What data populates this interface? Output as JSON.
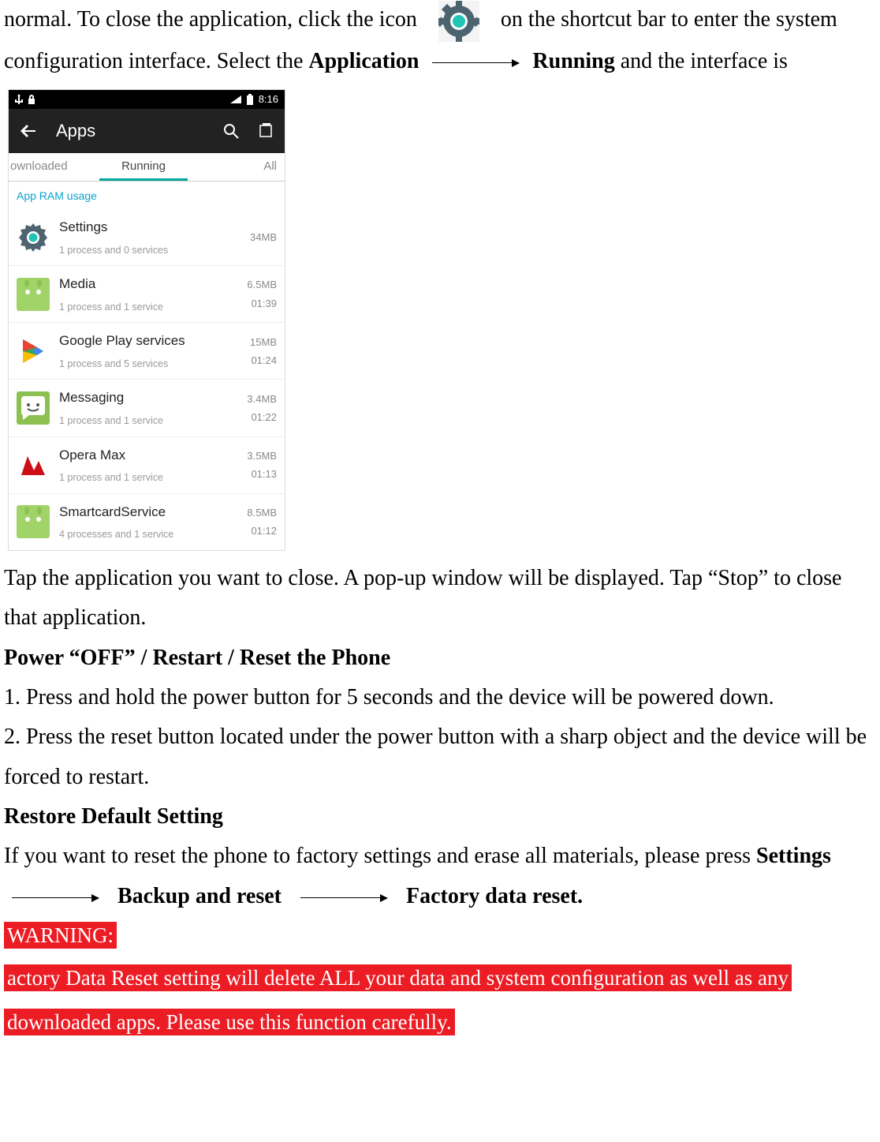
{
  "doc": {
    "p1_a": "normal. To close the application, click the icon",
    "p1_b": "on the shortcut bar to enter the system configuration interface. Select the ",
    "application_bold": "Application",
    "running_bold": "Running",
    "p1_c": " and the interface is",
    "p2": "Tap the application you want to close. A pop-up window will be displayed. Tap “Stop” to close that application.",
    "h1": "Power “OFF” / Restart / Reset the Phone",
    "li1": "1.    Press and hold the power button for 5 seconds and the device will be powered down.",
    "li2": "2. Press the reset button located under the power button with a sharp object and the device will be forced to restart.",
    "h2": "Restore Default Setting",
    "p3_a": "If you want to reset the phone to factory settings and erase all materials, please press ",
    "settings_bold": "Settings",
    "backup_bold": "Backup and reset",
    "factory_bold": "Factory data reset.",
    "warn_label": "WARNING:",
    "warn_text_a": "actory Data Reset setting will delete ALL your data and system conﬁguration as well as any",
    "warn_text_b": "downloaded apps. Please use this function carefully."
  },
  "phone": {
    "time": "8:16",
    "title": "Apps",
    "tabs": {
      "downloaded": "ownloaded",
      "running": "Running",
      "all": "All"
    },
    "section": "App RAM usage",
    "apps": [
      {
        "name": "Settings",
        "sub": "1 process and 0 services",
        "size": "34MB",
        "time": ""
      },
      {
        "name": "Media",
        "sub": "1 process and 1 service",
        "size": "6.5MB",
        "time": "01:39"
      },
      {
        "name": "Google Play services",
        "sub": "1 process and 5 services",
        "size": "15MB",
        "time": "01:24"
      },
      {
        "name": "Messaging",
        "sub": "1 process and 1 service",
        "size": "3.4MB",
        "time": "01:22"
      },
      {
        "name": "Opera Max",
        "sub": "1 process and 1 service",
        "size": "3.5MB",
        "time": "01:13"
      },
      {
        "name": "SmartcardService",
        "sub": "4 processes and 1 service",
        "size": "8.5MB",
        "time": "01:12"
      }
    ]
  }
}
